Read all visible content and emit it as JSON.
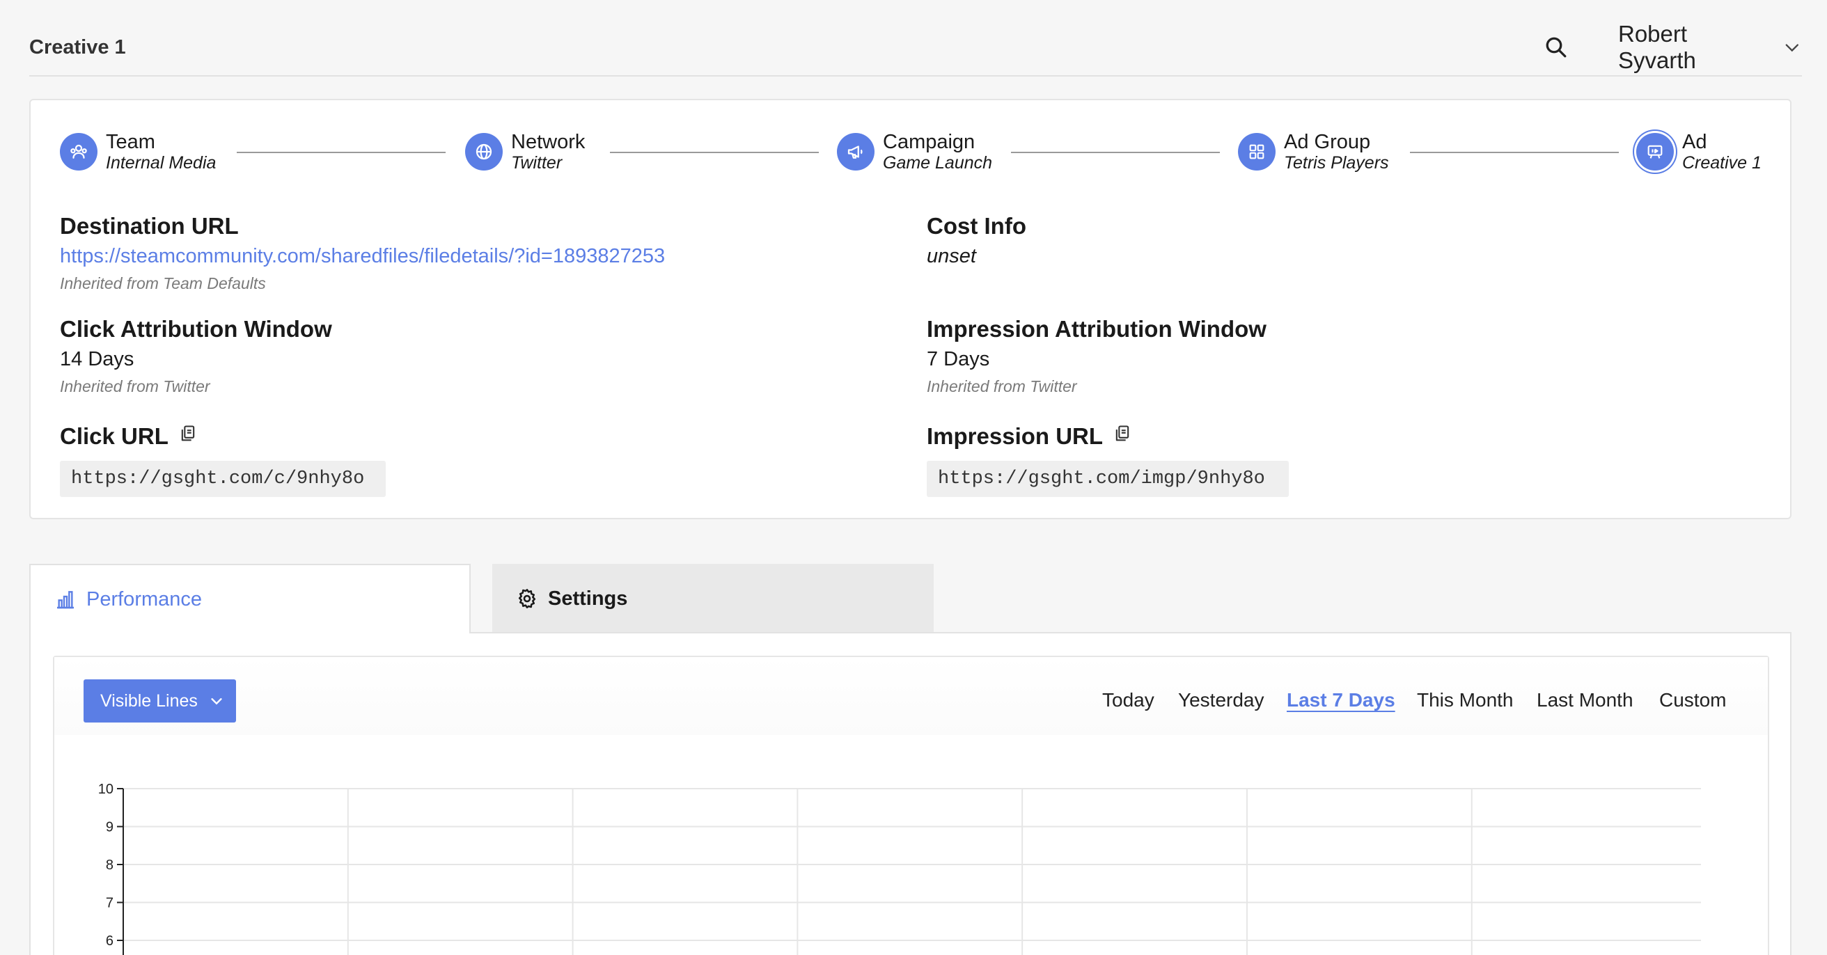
{
  "header": {
    "page_title": "Creative 1",
    "user_name": "Robert Syvarth"
  },
  "breadcrumb": [
    {
      "label": "Team",
      "sub": "Internal Media",
      "icon": "team-icon"
    },
    {
      "label": "Network",
      "sub": "Twitter",
      "icon": "globe-icon"
    },
    {
      "label": "Campaign",
      "sub": "Game Launch",
      "icon": "megaphone-icon"
    },
    {
      "label": "Ad Group",
      "sub": "Tetris Players",
      "icon": "grid-icon"
    },
    {
      "label": "Ad",
      "sub": "Creative 1",
      "icon": "ad-icon",
      "active": true
    }
  ],
  "details": {
    "destination_url": {
      "title": "Destination URL",
      "value": "https://steamcommunity.com/sharedfiles/filedetails/?id=1893827253",
      "note": "Inherited from Team Defaults"
    },
    "cost_info": {
      "title": "Cost Info",
      "value": "unset"
    },
    "click_window": {
      "title": "Click Attribution Window",
      "value": "14 Days",
      "note": "Inherited from Twitter"
    },
    "impression_window": {
      "title": "Impression Attribution Window",
      "value": "7 Days",
      "note": "Inherited from Twitter"
    },
    "click_url": {
      "title": "Click URL",
      "value": "https://gsght.com/c/9nhy8o"
    },
    "impression_url": {
      "title": "Impression URL",
      "value": "https://gsght.com/imgp/9nhy8o"
    }
  },
  "tabs": {
    "performance": "Performance",
    "settings": "Settings",
    "active": "performance"
  },
  "performance": {
    "visible_lines_label": "Visible Lines",
    "date_ranges": [
      "Today",
      "Yesterday",
      "Last 7 Days",
      "This Month",
      "Last Month",
      "Custom"
    ],
    "active_range": "Last 7 Days"
  },
  "colors": {
    "accent": "#5b7ee5",
    "background": "#f6f6f6",
    "gridline": "#e6e6e6"
  },
  "chart_data": {
    "type": "line",
    "y_ticks": [
      "10",
      "9",
      "8",
      "7",
      "6"
    ],
    "ylim": [
      0,
      10
    ],
    "x_sections": 7,
    "grid": true,
    "series": []
  }
}
